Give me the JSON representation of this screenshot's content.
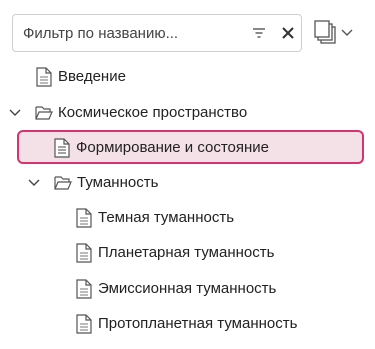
{
  "filter": {
    "placeholder": "Фильтр по названию..."
  },
  "tree": {
    "items": [
      {
        "label": "Введение",
        "type": "page"
      },
      {
        "label": "Космическое пространство",
        "type": "folder",
        "expanded": true
      },
      {
        "label": "Формирование и состояние",
        "type": "page-lines",
        "selected": true
      },
      {
        "label": "Туманность",
        "type": "folder",
        "expanded": true
      },
      {
        "label": "Темная туманность",
        "type": "page"
      },
      {
        "label": "Планетарная туманность",
        "type": "page"
      },
      {
        "label": "Эмиссионная туманность",
        "type": "page"
      },
      {
        "label": "Протопланетная туманность",
        "type": "page"
      }
    ]
  },
  "colors": {
    "selection_border": "#d7336e",
    "selection_fill": "#f4e1e7",
    "icon": "#555555"
  }
}
